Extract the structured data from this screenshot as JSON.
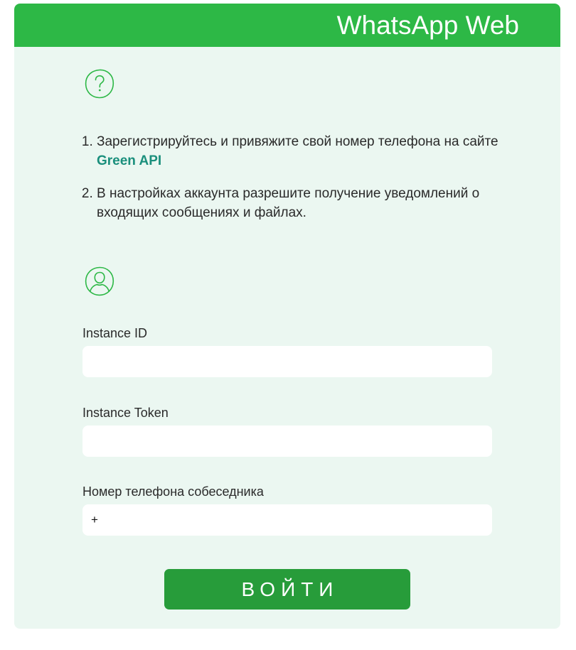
{
  "header": {
    "title": "WhatsApp Web"
  },
  "icons": {
    "help": "question-circle-icon",
    "user": "user-circle-icon"
  },
  "colors": {
    "brand_green": "#2db846",
    "button_green": "#279c3a",
    "card_background": "#ebf7f1",
    "link": "#1a8f7c"
  },
  "instructions": {
    "step1_text": "Зарегистрируйтесь и привяжите свой номер телефона на сайте ",
    "step1_link": "Green API",
    "step2_text": "В настройках аккаунта разрешите получение уведомлений о входящих сообщениях и файлах."
  },
  "form": {
    "instance_id_label": "Instance ID",
    "instance_id_value": "",
    "instance_token_label": "Instance Token",
    "instance_token_value": "",
    "phone_label": "Номер телефона собеседника",
    "phone_value": "+",
    "submit_label": "ВОЙТИ"
  }
}
